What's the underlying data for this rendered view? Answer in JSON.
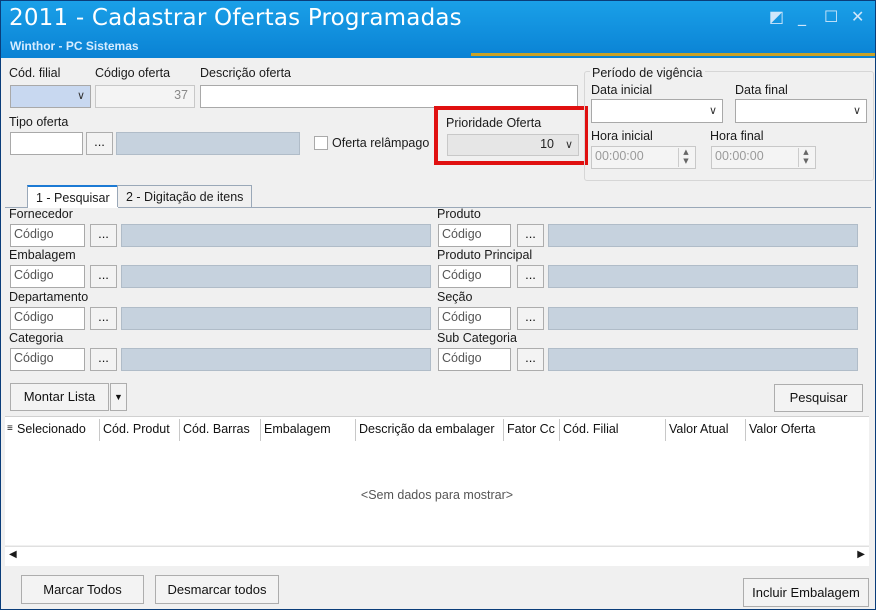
{
  "window": {
    "title": "2011 - Cadastrar Ofertas Programadas",
    "subtitle": "Winthor - PC Sistemas",
    "controls": [
      "◩",
      "_",
      "☐",
      "✕"
    ]
  },
  "header": {
    "cod_filial_label": "Cód. filial",
    "codigo_oferta_label": "Código oferta",
    "codigo_oferta_value": "37",
    "descricao_label": "Descrição oferta",
    "tipo_oferta_label": "Tipo oferta",
    "ellipsis": "...",
    "oferta_relampago_label": "Oferta relâmpago",
    "prioridade_label": "Prioridade Oferta",
    "prioridade_value": "10",
    "periodo_label": "Período de vigência",
    "data_inicial_label": "Data inicial",
    "data_final_label": "Data final",
    "hora_inicial_label": "Hora inicial",
    "hora_inicial_value": "00:00:00",
    "hora_final_label": "Hora final",
    "hora_final_value": "00:00:00"
  },
  "tabs": [
    {
      "label": "1 - Pesquisar"
    },
    {
      "label": "2 - Digitação de itens"
    }
  ],
  "filters": {
    "placeholder": "Código",
    "ellipsis": "...",
    "left": [
      "Fornecedor",
      "Embalagem",
      "Departamento",
      "Categoria"
    ],
    "right": [
      "Produto",
      "Produto Principal",
      "Seção",
      "Sub Categoria"
    ]
  },
  "actions": {
    "montar_lista": "Montar Lista",
    "pesquisar": "Pesquisar",
    "marcar_todos": "Marcar Todos",
    "desmarcar_todos": "Desmarcar todos",
    "incluir_embalagem": "Incluir Embalagem"
  },
  "grid": {
    "columns": [
      "Selecionado",
      "Cód. Produt",
      "Cód. Barras",
      "Embalagem",
      "Descrição da embalager",
      "Fator Cc",
      "Cód. Filial",
      "Valor Atual",
      "Valor Oferta"
    ],
    "empty_text": "<Sem dados para mostrar>"
  },
  "colors": {
    "titlebar": "#0a82d4",
    "highlight": "#e01010",
    "readonly_field": "#c6d2de"
  }
}
